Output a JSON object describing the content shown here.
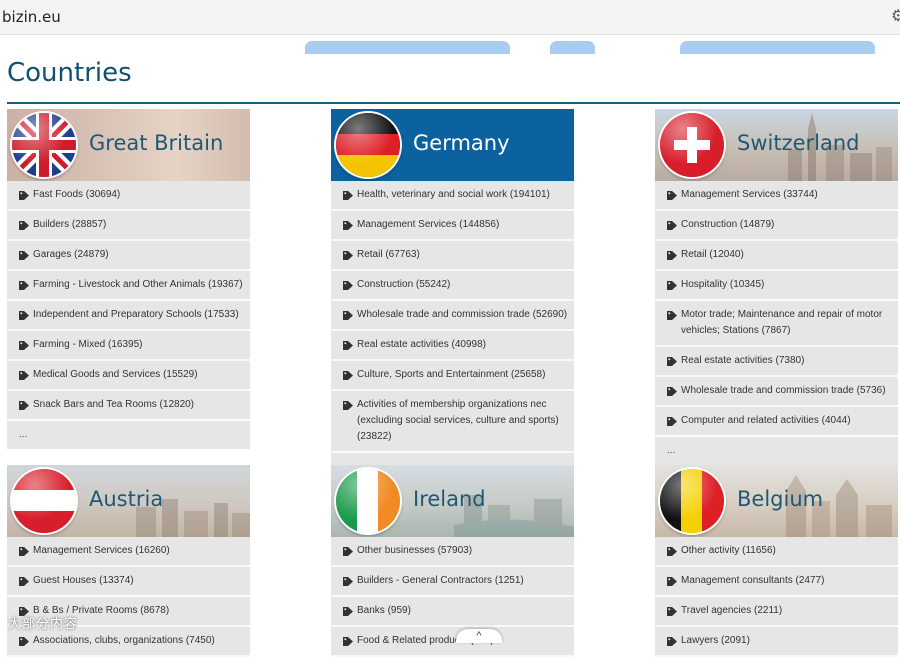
{
  "browser": {
    "url": "bizin.eu",
    "settings_icon": "gear-icon"
  },
  "page": {
    "title": "Countries"
  },
  "countries": [
    {
      "name": "Great Britain",
      "flag": "uk-flag",
      "items": [
        "Fast Foods (30694)",
        "Builders (28857)",
        "Garages (24879)",
        "Farming - Livestock and Other Animals (19367)",
        "Independent and Preparatory Schools (17533)",
        "Farming - Mixed (16395)",
        "Medical Goods and Services (15529)",
        "Snack Bars and Tea Rooms (12820)"
      ],
      "more": "..."
    },
    {
      "name": "Germany",
      "flag": "germany-flag",
      "items": [
        "Health, veterinary and social work (194101)",
        "Management Services (144856)",
        "Retail (67763)",
        "Construction (55242)",
        "Wholesale trade and commission trade (52690)",
        "Real estate activities (40998)",
        "Culture, Sports and Entertainment (25658)",
        "Activities of membership organizations nec (excluding social services, culture and sports) (23822)"
      ],
      "more": "..."
    },
    {
      "name": "Switzerland",
      "flag": "switzerland-flag",
      "items": [
        "Management Services (33744)",
        "Construction (14879)",
        "Retail (12040)",
        "Hospitality (10345)",
        "Motor trade; Maintenance and repair of motor vehicles; Stations (7867)",
        "Real estate activities (7380)",
        "Wholesale trade and commission trade (5736)",
        "Computer and related activities (4044)"
      ],
      "more": "..."
    },
    {
      "name": "Austria",
      "flag": "austria-flag",
      "items": [
        "Management Services (16260)",
        "Guest Houses (13374)",
        "B & Bs / Private Rooms (8678)",
        "Associations, clubs, organizations (7450)"
      ]
    },
    {
      "name": "Ireland",
      "flag": "ireland-flag",
      "items": [
        "Other businesses (57903)",
        "Builders - General Contractors (1251)",
        "Banks (959)",
        "Food & Related products (621)"
      ]
    },
    {
      "name": "Belgium",
      "flag": "belgium-flag",
      "items": [
        "Other activity (11656)",
        "Management consultants (2477)",
        "Travel agencies (2211)",
        "Lawyers (2091)"
      ]
    }
  ],
  "watermark": {
    "text": "大部分内容"
  },
  "scroll_button": {
    "label": "^"
  },
  "colors": {
    "title": "#124f70",
    "germany_banner": "#0c629e",
    "item_bg": "#e6e6e6"
  }
}
